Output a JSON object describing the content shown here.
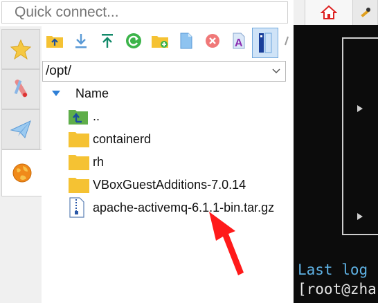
{
  "quick_connect": {
    "placeholder": "Quick connect..."
  },
  "top_tabs": [
    {
      "name": "home",
      "icon": "house-icon"
    },
    {
      "name": "session",
      "icon": "wrench-icon"
    }
  ],
  "side_tabs": [
    {
      "name": "sessions",
      "icon": "star-icon"
    },
    {
      "name": "tools",
      "icon": "tools-icon"
    },
    {
      "name": "macros",
      "icon": "paper-plane-icon"
    },
    {
      "name": "sftp",
      "icon": "globe-icon",
      "active": true
    }
  ],
  "toolbar": {
    "buttons": [
      {
        "name": "parent-directory",
        "icon": "folder-up-icon"
      },
      {
        "name": "download",
        "icon": "download-icon"
      },
      {
        "name": "upload",
        "icon": "upload-icon"
      },
      {
        "name": "refresh",
        "icon": "refresh-icon"
      },
      {
        "name": "new-folder",
        "icon": "new-folder-icon"
      },
      {
        "name": "new-file",
        "icon": "new-file-icon"
      },
      {
        "name": "delete",
        "icon": "delete-icon"
      },
      {
        "name": "permissions",
        "icon": "text-icon"
      },
      {
        "name": "follow-terminal",
        "icon": "terminal-follow-icon",
        "pressed": true
      }
    ]
  },
  "path": {
    "value": "/opt/"
  },
  "file_list": {
    "column_header": "Name",
    "sort": "ascending",
    "items": [
      {
        "name": "..",
        "type": "parent"
      },
      {
        "name": "containerd",
        "type": "folder"
      },
      {
        "name": "rh",
        "type": "folder"
      },
      {
        "name": "VBoxGuestAdditions-7.0.14",
        "type": "folder"
      },
      {
        "name": "apache-activemq-6.1.1-bin.tar.gz",
        "type": "archive"
      }
    ]
  },
  "terminal": {
    "lines": [
      {
        "text": "Last log",
        "color": "#5fb3e6"
      },
      {
        "text": "[root@zha",
        "color": "#e6e6e6"
      }
    ]
  },
  "colors": {
    "folder": "#f5c233",
    "annotation_arrow": "#ff1a1a",
    "terminal_bg": "#0c0c0c"
  }
}
